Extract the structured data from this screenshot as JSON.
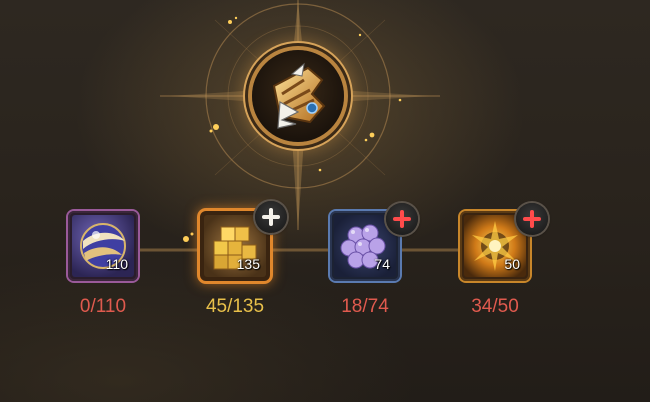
{
  "colors": {
    "insufficient": "#e05a4e",
    "progress_yellow": "#e8c04a"
  },
  "equipment": {
    "icon": "gauntlet-icon"
  },
  "materials": [
    {
      "icon": "sphere-orb-icon",
      "count": "110",
      "progress": "0/110",
      "color": "#e05a4e",
      "add_button": null
    },
    {
      "icon": "gold-cubes-icon",
      "count": "135",
      "progress": "45/135",
      "color": "#e8c04a",
      "add_button": "white-plus-icon"
    },
    {
      "icon": "purple-grapes-icon",
      "count": "74",
      "progress": "18/74",
      "color": "#e05a4e",
      "add_button": "red-plus-icon"
    },
    {
      "icon": "golden-burst-icon",
      "count": "50",
      "progress": "34/50",
      "color": "#e05a4e",
      "add_button": "red-plus-icon"
    }
  ]
}
